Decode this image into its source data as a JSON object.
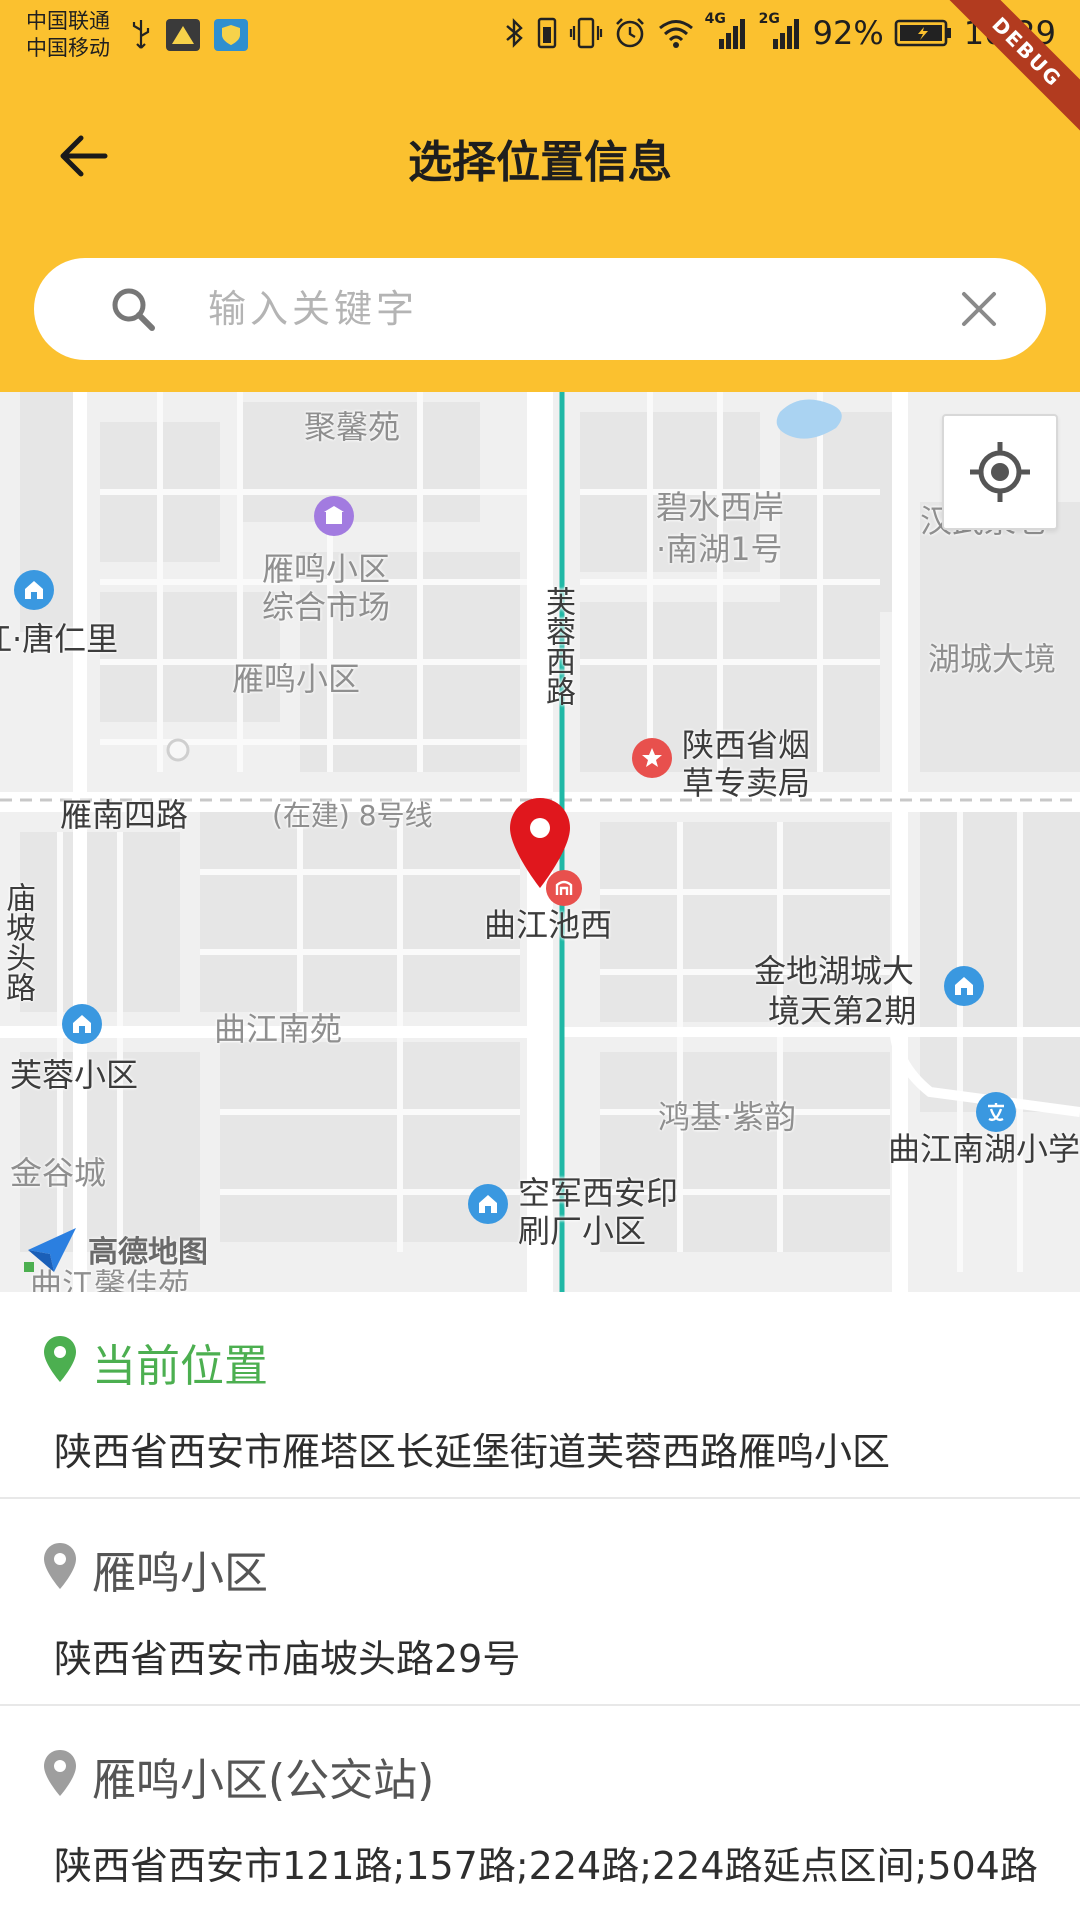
{
  "status_bar": {
    "carrier_1": "中国联通",
    "carrier_2": "中国移动",
    "network_1": "4G",
    "network_2": "2G",
    "battery_percent": "92%",
    "time": "10:29",
    "debug_badge": "DEBUG"
  },
  "header": {
    "title": "选择位置信息",
    "back_icon": "arrow-left-icon"
  },
  "search": {
    "placeholder": "输入关键字",
    "value": "",
    "search_icon": "search-icon",
    "clear_icon": "close-icon"
  },
  "map": {
    "provider_logo": "高德地图",
    "locate_icon": "crosshair-icon",
    "labels": {
      "jxy": "聚馨苑",
      "bsxa": "碧水西岸",
      "nh1": "·南湖1号",
      "hwqx": "汉武泉巷",
      "ymxq_market_1": "雁鸣小区",
      "ymxq_market_2": "综合市场",
      "trl": "江·唐仁里",
      "frxl": "芙蓉西路",
      "hcdj": "湖城大境",
      "ymxq": "雁鸣小区",
      "ycj_1": "陕西省烟",
      "ycj_2": "草专卖局",
      "ynsl": "雁南四路",
      "line8": "(在建) 8号线",
      "qjcx": "曲江池西",
      "mptl": "庙坡头路",
      "jdhc_1": "金地湖城大",
      "jdhc_2": "境天第2期",
      "qjny": "曲江南苑",
      "frxq": "芙蓉小区",
      "hjzy": "鸿基·紫韵",
      "qjnhxx": "曲江南湖小学",
      "jgc": "金谷城",
      "kjxa_1": "空军西安印",
      "kjxa_2": "刷厂小区",
      "qjxjy": "曲江馨佳苑"
    }
  },
  "locations": [
    {
      "name": "当前位置",
      "address": "陕西省西安市雁塔区长延堡街道芙蓉西路雁鸣小区",
      "pin_color": "#4caf50",
      "is_current": true
    },
    {
      "name": "雁鸣小区",
      "address": "陕西省西安市庙坡头路29号",
      "pin_color": "#9e9e9e",
      "is_current": false
    },
    {
      "name": "雁鸣小区(公交站)",
      "address": "陕西省西安市121路;157路;224路;224路延点区间;504路",
      "pin_color": "#9e9e9e",
      "is_current": false
    }
  ],
  "colors": {
    "header_bg": "#fbc12f",
    "current_green": "#4caf50",
    "pin_red": "#e0171d",
    "subway_teal": "#20b8a6"
  }
}
